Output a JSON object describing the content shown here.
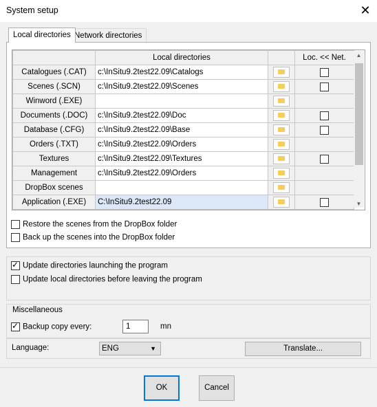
{
  "window": {
    "title": "System setup"
  },
  "tabs": [
    "Local directories",
    "Network directories"
  ],
  "grid": {
    "col_local": "Local directories",
    "col_net": "Loc. << Net.",
    "rows": [
      {
        "label": "Catalogues (.CAT)",
        "path": "c:\\InSitu9.2test22.09\\Catalogs",
        "check": false,
        "has_check": true
      },
      {
        "label": "Scenes (.SCN)",
        "path": "c:\\InSitu9.2test22.09\\Scenes",
        "check": false,
        "has_check": true
      },
      {
        "label": "Winword (.EXE)",
        "path": "",
        "check": false,
        "has_check": false
      },
      {
        "label": "Documents (.DOC)",
        "path": "c:\\InSitu9.2test22.09\\Doc",
        "check": false,
        "has_check": true
      },
      {
        "label": "Database (.CFG)",
        "path": "c:\\InSitu9.2test22.09\\Base",
        "check": false,
        "has_check": true
      },
      {
        "label": "Orders (.TXT)",
        "path": "c:\\InSitu9.2test22.09\\Orders",
        "check": false,
        "has_check": false
      },
      {
        "label": "Textures",
        "path": "c:\\InSitu9.2test22.09\\Textures",
        "check": false,
        "has_check": true
      },
      {
        "label": "Management",
        "path": "c:\\InSitu9.2test22.09\\Orders",
        "check": false,
        "has_check": false
      },
      {
        "label": "DropBox scenes",
        "path": "",
        "check": false,
        "has_check": false
      },
      {
        "label": "Application (.EXE)",
        "path": "C:\\InSitu9.2test22.09",
        "check": false,
        "has_check": true
      }
    ]
  },
  "dropbox": {
    "restore": "Restore the scenes from the DropBox folder",
    "backup": "Back up the scenes into the DropBox folder"
  },
  "update": {
    "launch": "Update directories launching the program",
    "launch_checked": true,
    "leave": "Update local directories before leaving the program",
    "leave_checked": false
  },
  "misc": {
    "title": "Miscellaneous",
    "backup_label": "Backup copy every:",
    "backup_checked": true,
    "backup_value": "1",
    "unit": "mn"
  },
  "language": {
    "label": "Language:",
    "value": "ENG",
    "translate": "Translate..."
  },
  "buttons": {
    "ok": "OK",
    "cancel": "Cancel"
  }
}
